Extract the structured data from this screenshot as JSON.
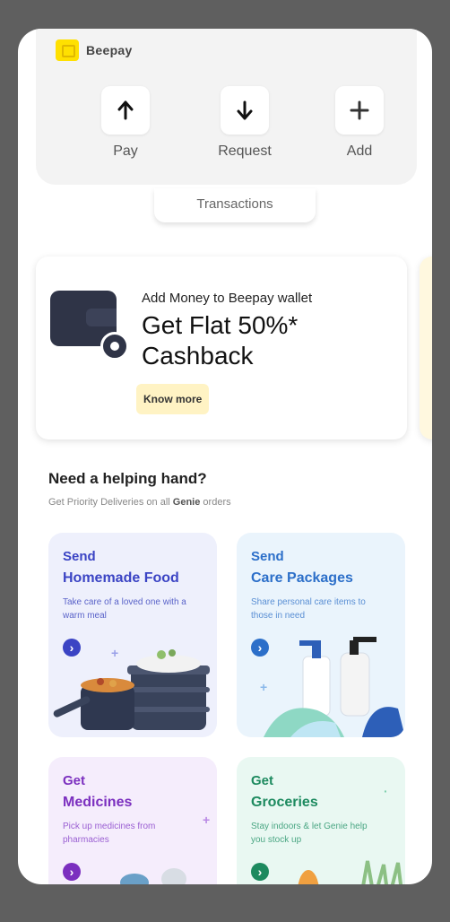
{
  "app": {
    "brand": "Beepay"
  },
  "wallet": {
    "actions": [
      {
        "label": "Pay",
        "icon": "arrow-up-icon"
      },
      {
        "label": "Request",
        "icon": "arrow-down-icon"
      },
      {
        "label": "Add",
        "icon": "plus-icon"
      }
    ],
    "transactions_tab": "Transactions"
  },
  "promo": {
    "subtitle": "Add Money to Beepay wallet",
    "title": "Get Flat 50%* Cashback",
    "button": "Know more"
  },
  "help": {
    "title": "Need a helping hand?",
    "subtitle_prefix": "Get Priority Deliveries on all",
    "subtitle_brand": "Genie",
    "subtitle_suffix": "orders"
  },
  "tiles": [
    {
      "line1": "Send",
      "line2": "Homemade Food",
      "desc": "Take care of a loved one with a warm meal",
      "color": "#3b44c4",
      "bg": "#eef0fc"
    },
    {
      "line1": "Send",
      "line2": "Care Packages",
      "desc": "Share personal care items to those in need",
      "color": "#2c6fc9",
      "bg": "#eaf4fc"
    },
    {
      "line1": "Get",
      "line2": "Medicines",
      "desc": "Pick up medicines from pharmacies",
      "color": "#7b2fbf",
      "bg": "#f5edfc"
    },
    {
      "line1": "Get",
      "line2": "Groceries",
      "desc": "Stay indoors & let Genie help you stock up",
      "color": "#1d8a5f",
      "bg": "#e9f8f2"
    }
  ]
}
